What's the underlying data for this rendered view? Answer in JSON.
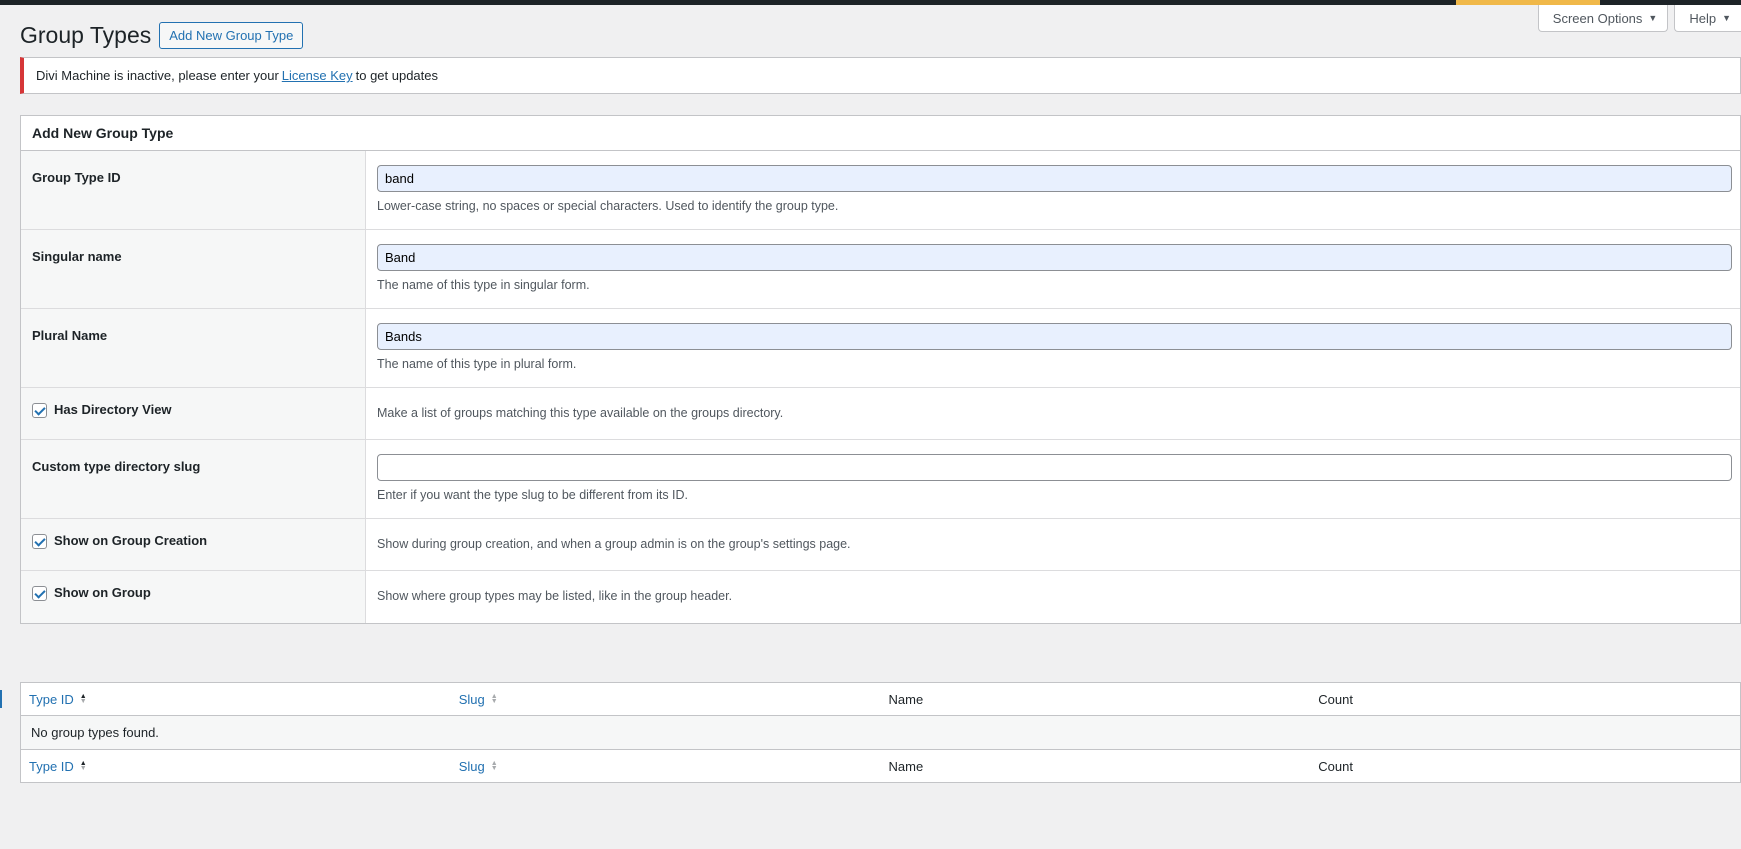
{
  "screen_options": {
    "screen_options_label": "Screen Options",
    "help_label": "Help"
  },
  "header": {
    "title": "Group Types",
    "add_new_label": "Add New Group Type"
  },
  "notice": {
    "text_before": "Divi Machine is inactive, please enter your",
    "link_text": "License Key",
    "text_after": "to get updates"
  },
  "form": {
    "title": "Add New Group Type",
    "group_type_id": {
      "label": "Group Type ID",
      "value": "band",
      "description": "Lower-case string, no spaces or special characters. Used to identify the group type."
    },
    "singular_name": {
      "label": "Singular name",
      "value": "Band",
      "description": "The name of this type in singular form."
    },
    "plural_name": {
      "label": "Plural Name",
      "value": "Bands",
      "description": "The name of this type in plural form."
    },
    "has_directory": {
      "label": "Has Directory View",
      "checked": true,
      "description": "Make a list of groups matching this type available on the groups directory."
    },
    "directory_slug": {
      "label": "Custom type directory slug",
      "value": "",
      "description": "Enter if you want the type slug to be different from its ID."
    },
    "show_on_creation": {
      "label": "Show on Group Creation",
      "checked": true,
      "description": "Show during group creation, and when a group admin is on the group's settings page."
    },
    "show_on_group": {
      "label": "Show on Group",
      "checked": true,
      "description": "Show where group types may be listed, like in the group header."
    }
  },
  "table": {
    "columns": [
      "Type ID",
      "Slug",
      "Name",
      "Count"
    ],
    "empty_message": "No group types found."
  }
}
